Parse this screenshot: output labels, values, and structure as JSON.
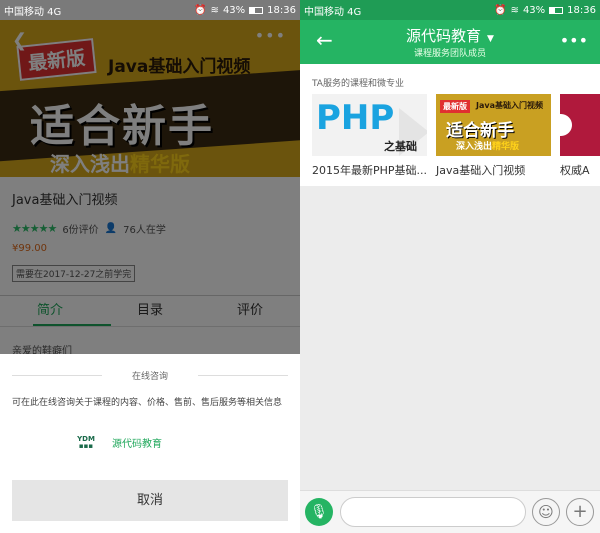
{
  "left": {
    "status": {
      "carrier": "中国移动 4G",
      "battery": "43%",
      "time": "18:36",
      "battery_level": 0.43
    },
    "banner": {
      "tag": "最新版",
      "subtitle": "Java基础入门视频",
      "headline": "适合新手",
      "bottom_plain": "深入浅出",
      "bottom_highlight": "精华版"
    },
    "course": {
      "title": "Java基础入门视频",
      "reviews": "6份评价",
      "learners": "76人在学",
      "price": "¥99.00",
      "deadline": "需要在2017-12-27之前学完",
      "rating": 5
    },
    "tabs": [
      "简介",
      "目录",
      "评价"
    ],
    "intro_peek": "亲爱的鞋癖们",
    "sheet": {
      "title": "在线咨询",
      "description": "可在此在线咨询关于课程的内容、价格、售前、售后服务等相关信息",
      "provider_name": "源代码教育",
      "cancel": "取消"
    }
  },
  "right": {
    "status": {
      "carrier": "中国移动 4G",
      "battery": "43%",
      "time": "18:36",
      "battery_level": 0.43
    },
    "header": {
      "title": "源代码教育",
      "subtitle": "课程服务团队成员"
    },
    "section_label": "TA服务的课程和微专业",
    "courses": [
      {
        "name": "2015年最新PHP基础...",
        "thumb_main": "PHP",
        "thumb_sub": "之基础"
      },
      {
        "name": "Java基础入门视频",
        "thumb_tag": "最新版",
        "thumb_sub": "Java基础入门视频",
        "thumb_main": "适合新手",
        "thumb_bottom_plain": "深入浅出",
        "thumb_bottom_highlight": "精华版"
      },
      {
        "name": "权威A"
      }
    ]
  }
}
